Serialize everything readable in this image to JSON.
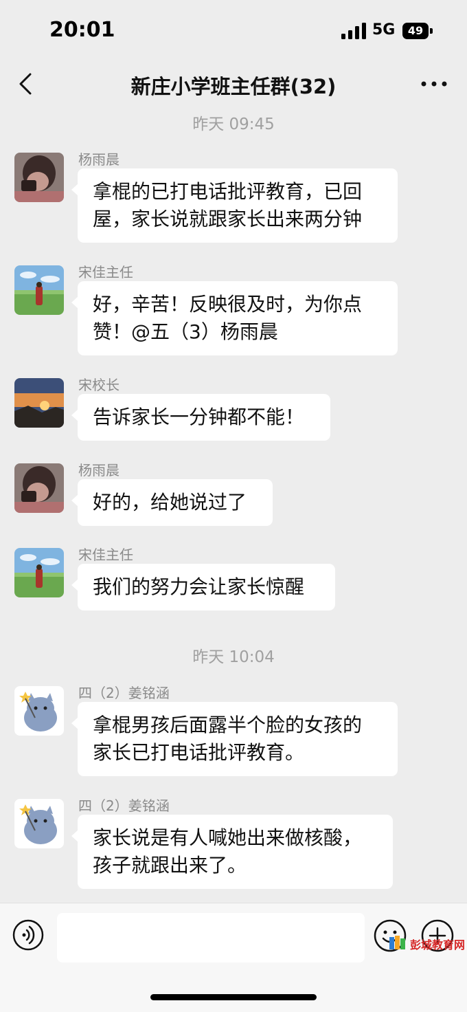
{
  "status_bar": {
    "time": "20:01",
    "network": "5G",
    "battery": "49"
  },
  "header": {
    "title": "新庄小学班主任群(32)"
  },
  "timestamps": [
    "昨天 09:45",
    "昨天 10:04"
  ],
  "messages": [
    {
      "sender": "杨雨晨",
      "lines": [
        "拿棍的已打电话批评教育，已回",
        "屋，家长说就跟家长出来两分钟"
      ]
    },
    {
      "sender": "宋佳主任",
      "lines": [
        "好，辛苦！反映很及时，为你点",
        "赞！@五（3）杨雨晨"
      ]
    },
    {
      "sender": "宋校长",
      "lines": [
        "告诉家长一分钟都不能！"
      ]
    },
    {
      "sender": "杨雨晨",
      "lines": [
        "好的，给她说过了"
      ]
    },
    {
      "sender": "宋佳主任",
      "lines": [
        "我们的努力会让家长惊醒"
      ]
    },
    {
      "sender": "四（2）姜铭涵",
      "lines": [
        "拿棍男孩后面露半个脸的女孩的",
        "家长已打电话批评教育。"
      ]
    },
    {
      "sender": "四（2）姜铭涵",
      "lines": [
        "家长说是有人喊她出来做核酸，",
        "孩子就跟出来了。"
      ]
    }
  ],
  "watermark": {
    "text": "彭城教育网"
  },
  "colors": {
    "background": "#ededed",
    "bubble": "#ffffff",
    "meta_text": "#a0a0a0"
  }
}
